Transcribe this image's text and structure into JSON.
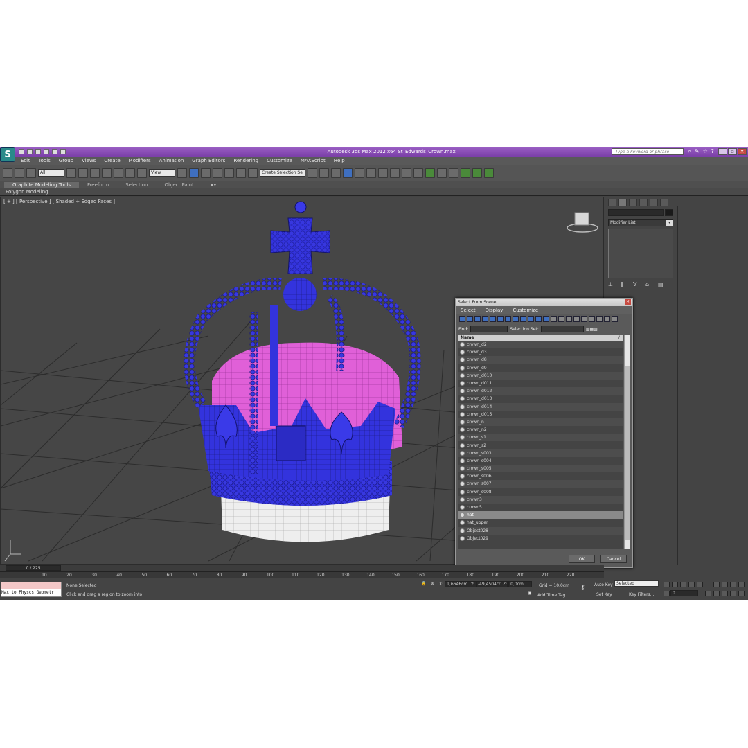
{
  "app": {
    "logo_glyph": "S",
    "title": "Autodesk 3ds Max  2012 x64     St_Edwards_Crown.max",
    "help_search_placeholder": "Type a keyword or phrase"
  },
  "window_controls": {
    "minimize": "–",
    "restore": "▫",
    "close": "✕"
  },
  "menu": [
    "Edit",
    "Tools",
    "Group",
    "Views",
    "Create",
    "Modifiers",
    "Animation",
    "Graph Editors",
    "Rendering",
    "Customize",
    "MAXScript",
    "Help"
  ],
  "toolbar": {
    "selection_filter": "All",
    "reference_coord": "View",
    "named_selection": "Create Selection Se"
  },
  "ribbon": {
    "tabs": [
      "Graphite Modeling Tools",
      "Freeform",
      "Selection",
      "Object Paint"
    ],
    "active_tab": "Graphite Modeling Tools",
    "panel_label": "Polygon Modeling"
  },
  "viewport": {
    "label": "[ + ] [ Perspective ] [ Shaded + Edged Faces ]",
    "colors": {
      "background": "#464646",
      "grid": "#2a2a2a",
      "metal": "#3333dd",
      "velvet": "#e060d8",
      "ermine": "#eeeeee"
    }
  },
  "command_panel": {
    "modifier_list": "Modifier List"
  },
  "dialog": {
    "title": "Select From Scene",
    "menu": [
      "Select",
      "Display",
      "Customize"
    ],
    "find_label": "Find:",
    "selection_set_label": "Selection Set:",
    "name_header": "Name",
    "sort_indicator": "/",
    "items": [
      "crown_d2",
      "crown_d3",
      "crown_d8",
      "crown_d9",
      "crown_d010",
      "crown_d011",
      "crown_d012",
      "crown_d013",
      "crown_d014",
      "crown_d015",
      "crown_n",
      "crown_n2",
      "crown_s1",
      "crown_s2",
      "crown_s003",
      "crown_s004",
      "crown_s005",
      "crown_s006",
      "crown_s007",
      "crown_s008",
      "crown3",
      "crown5",
      "hat",
      "hat_upper",
      "Object028",
      "Object029"
    ],
    "selected_item": "hat",
    "ok_label": "OK",
    "cancel_label": "Cancel"
  },
  "timeline": {
    "time_display": "0 / 225",
    "ticks": [
      "10",
      "20",
      "30",
      "40",
      "50",
      "60",
      "70",
      "80",
      "90",
      "100",
      "110",
      "120",
      "130",
      "140",
      "150",
      "160",
      "170",
      "180",
      "190",
      "200",
      "210",
      "220"
    ]
  },
  "status": {
    "maxscript_output": "Max to Physcs Geometr",
    "selection": "None Selected",
    "prompt": "Click and drag a region to zoom into",
    "x_label": "X:",
    "x_value": "1,6646cm",
    "y_label": "Y:",
    "y_value": "-49,4504cr",
    "z_label": "Z:",
    "z_value": "0,0cm",
    "grid": "Grid = 10,0cm",
    "add_time_tag": "Add Time Tag",
    "auto_key": "Auto Key",
    "key_mode": "Selected",
    "set_key": "Set Key",
    "key_filters": "Key Filters...",
    "current_frame": "0"
  }
}
